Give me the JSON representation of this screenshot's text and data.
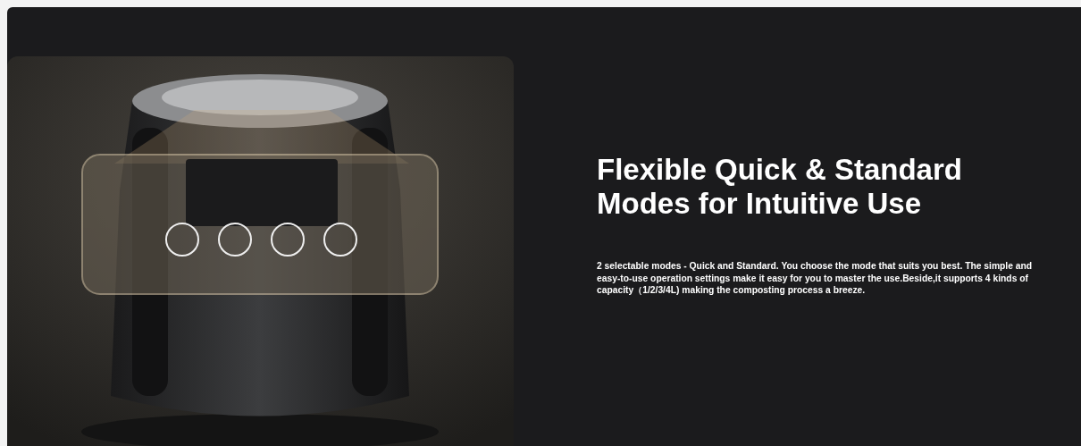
{
  "hero": {
    "heading": "Flexible Quick & Standard Modes for Intuitive Use",
    "description": "2 selectable modes - Quick and Standard. You choose the mode that suits you best. The simple and easy-to-use operation settings make it easy for you to master the use.Beside,it supports 4 kinds of capacity（1/2/3/4L) making the composting process a breeze."
  }
}
